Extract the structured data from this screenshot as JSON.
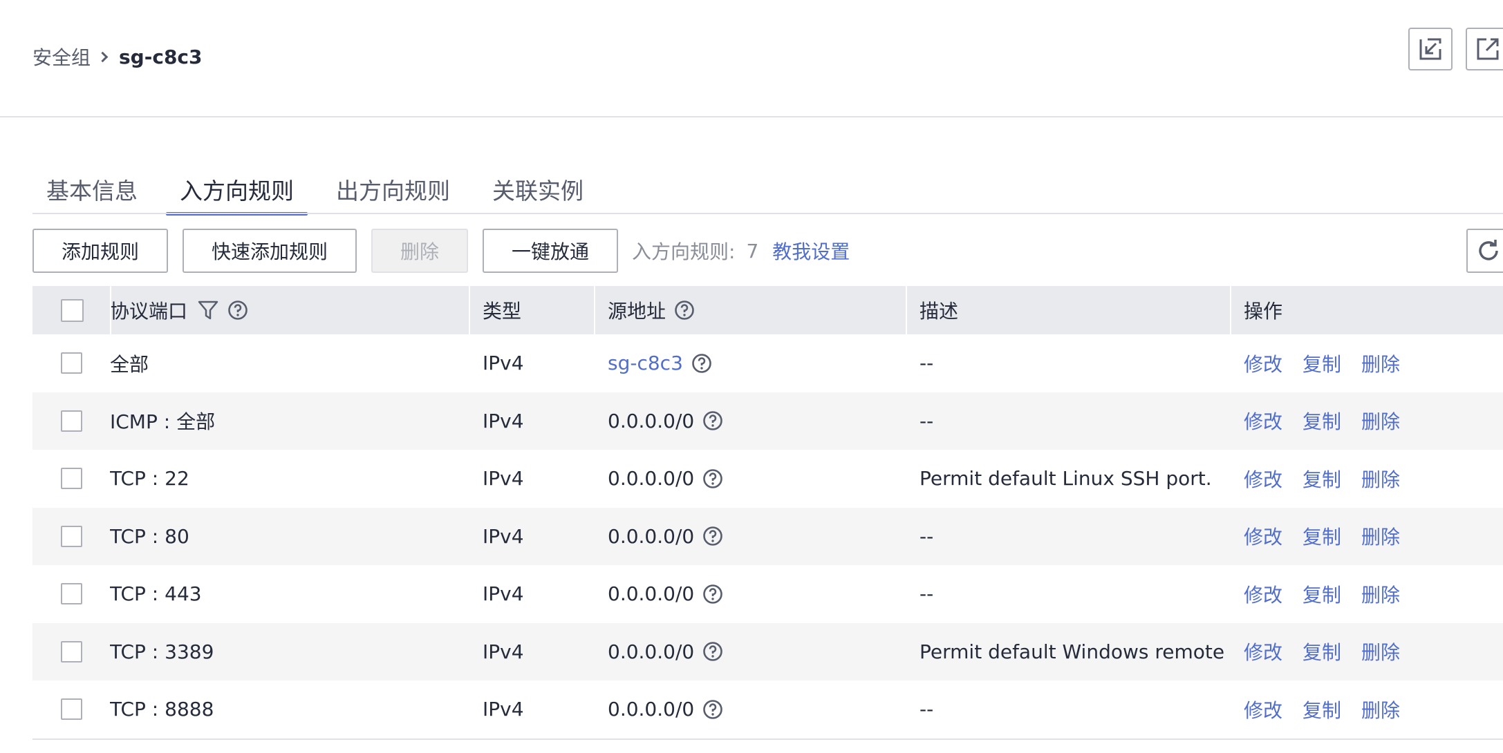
{
  "breadcrumb": {
    "parent": "安全组",
    "current": "sg-c8c3"
  },
  "header": {
    "icons": [
      "restore-window-icon",
      "open-external-icon"
    ]
  },
  "tabs": [
    {
      "label": "基本信息",
      "active": false
    },
    {
      "label": "入方向规则",
      "active": true
    },
    {
      "label": "出方向规则",
      "active": false
    },
    {
      "label": "关联实例",
      "active": false
    }
  ],
  "toolbar": {
    "add_rule": "添加规则",
    "quick_add_rule": "快速添加规则",
    "delete": "删除",
    "one_click_open": "一键放通",
    "rule_count_label": "入方向规则:",
    "rule_count": "7",
    "help_link": "教我设置"
  },
  "table": {
    "headers": {
      "protocol_port": "协议端口",
      "type": "类型",
      "source": "源地址",
      "description": "描述",
      "operations": "操作"
    },
    "rows": [
      {
        "protocol_port": "全部",
        "type": "IPv4",
        "source": "sg-c8c3",
        "source_is_link": true,
        "description": "--"
      },
      {
        "protocol_port": "ICMP : 全部",
        "type": "IPv4",
        "source": "0.0.0.0/0",
        "source_is_link": false,
        "description": "--"
      },
      {
        "protocol_port": "TCP : 22",
        "type": "IPv4",
        "source": "0.0.0.0/0",
        "source_is_link": false,
        "description": "Permit default Linux SSH port."
      },
      {
        "protocol_port": "TCP : 80",
        "type": "IPv4",
        "source": "0.0.0.0/0",
        "source_is_link": false,
        "description": "--"
      },
      {
        "protocol_port": "TCP : 443",
        "type": "IPv4",
        "source": "0.0.0.0/0",
        "source_is_link": false,
        "description": "--"
      },
      {
        "protocol_port": "TCP : 3389",
        "type": "IPv4",
        "source": "0.0.0.0/0",
        "source_is_link": false,
        "description": "Permit default Windows remote ..."
      },
      {
        "protocol_port": "TCP : 8888",
        "type": "IPv4",
        "source": "0.0.0.0/0",
        "source_is_link": false,
        "description": "--"
      }
    ],
    "row_actions": {
      "edit": "修改",
      "copy": "复制",
      "delete": "删除"
    }
  },
  "colors": {
    "accent": "#526ecc",
    "header_bg": "#e8eaed",
    "alt_row": "#f5f5f6"
  }
}
